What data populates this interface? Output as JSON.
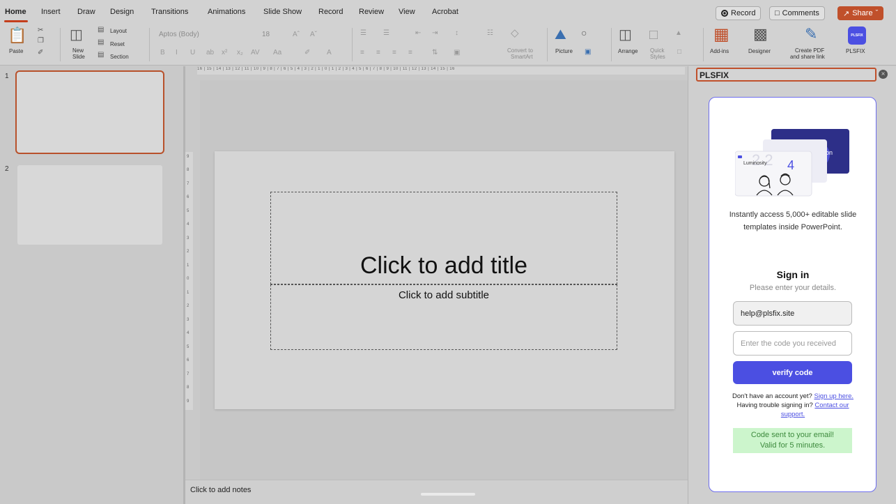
{
  "tabs": [
    {
      "label": "Home"
    },
    {
      "label": "Insert"
    },
    {
      "label": "Draw"
    },
    {
      "label": "Design"
    },
    {
      "label": "Transitions"
    },
    {
      "label": "Animations"
    },
    {
      "label": "Slide Show"
    },
    {
      "label": "Record"
    },
    {
      "label": "Review"
    },
    {
      "label": "View"
    },
    {
      "label": "Acrobat"
    }
  ],
  "top_buttons": {
    "record": "Record",
    "comments": "Comments",
    "share": "Share"
  },
  "ribbon": {
    "paste": "Paste",
    "new_slide_1": "New",
    "new_slide_2": "Slide",
    "layout": "Layout",
    "reset": "Reset",
    "section": "Section",
    "font_name": "Aptos (Body)",
    "font_size": "18",
    "convert_1": "Convert to",
    "convert_2": "SmartArt",
    "picture": "Picture",
    "arrange": "Arrange",
    "quick_1": "Quick",
    "quick_2": "Styles",
    "addins": "Add-ins",
    "designer": "Designer",
    "create_pdf_1": "Create PDF",
    "create_pdf_2": "and share link",
    "plsfix": "PLSFIX",
    "plsfix_icon_text": "PLSFIX"
  },
  "thumbnails": [
    {
      "number": "1"
    },
    {
      "number": "2"
    }
  ],
  "ruler_top_text": "16 | 15 | 14 | 13 | 12 | 11 | 10 | 9 | 8 | 7 | 6 | 5 | 4 | 3 | 2 | 1 | 0 | 1 | 2 | 3 | 4 | 5 | 6 | 7 | 8 | 9 | 10 | 11 | 12 | 13 | 14 | 15 | 16",
  "ruler_left": [
    "9",
    "8",
    "7",
    "6",
    "5",
    "4",
    "3",
    "2",
    "1",
    "0",
    "1",
    "2",
    "3",
    "4",
    "5",
    "6",
    "7",
    "8",
    "9"
  ],
  "slide": {
    "title_placeholder": "Click to add title",
    "subtitle_placeholder": "Click to add subtitle"
  },
  "notes_placeholder": "Click to add notes",
  "addin": {
    "title": "PLSFIX",
    "close_icon": "close-icon",
    "illustration_text_1": "Luminosity",
    "illustration_text_2": "4",
    "illustration_text_3": "on",
    "description": "Instantly access 5,000+ editable slide templates inside PowerPoint.",
    "sign_in_title": "Sign in",
    "sign_in_subtitle": "Please enter your details.",
    "email_value": "help@plsfix.site",
    "code_placeholder": "Enter the code you received",
    "verify_label": "verify code",
    "help_prefix": "Don't have an account yet? ",
    "signup_link": "Sign up here.",
    "help_mid": " Having trouble signing in? ",
    "support_link": "Contact our support.",
    "success_line_1": "Code sent to your email!",
    "success_line_2": "Valid for 5 minutes."
  },
  "colors": {
    "accent": "#4b4fe2",
    "share": "#c0502b",
    "selection": "#b8512b",
    "success_bg": "#ccf5cc",
    "success_text": "#3d8a3d"
  }
}
